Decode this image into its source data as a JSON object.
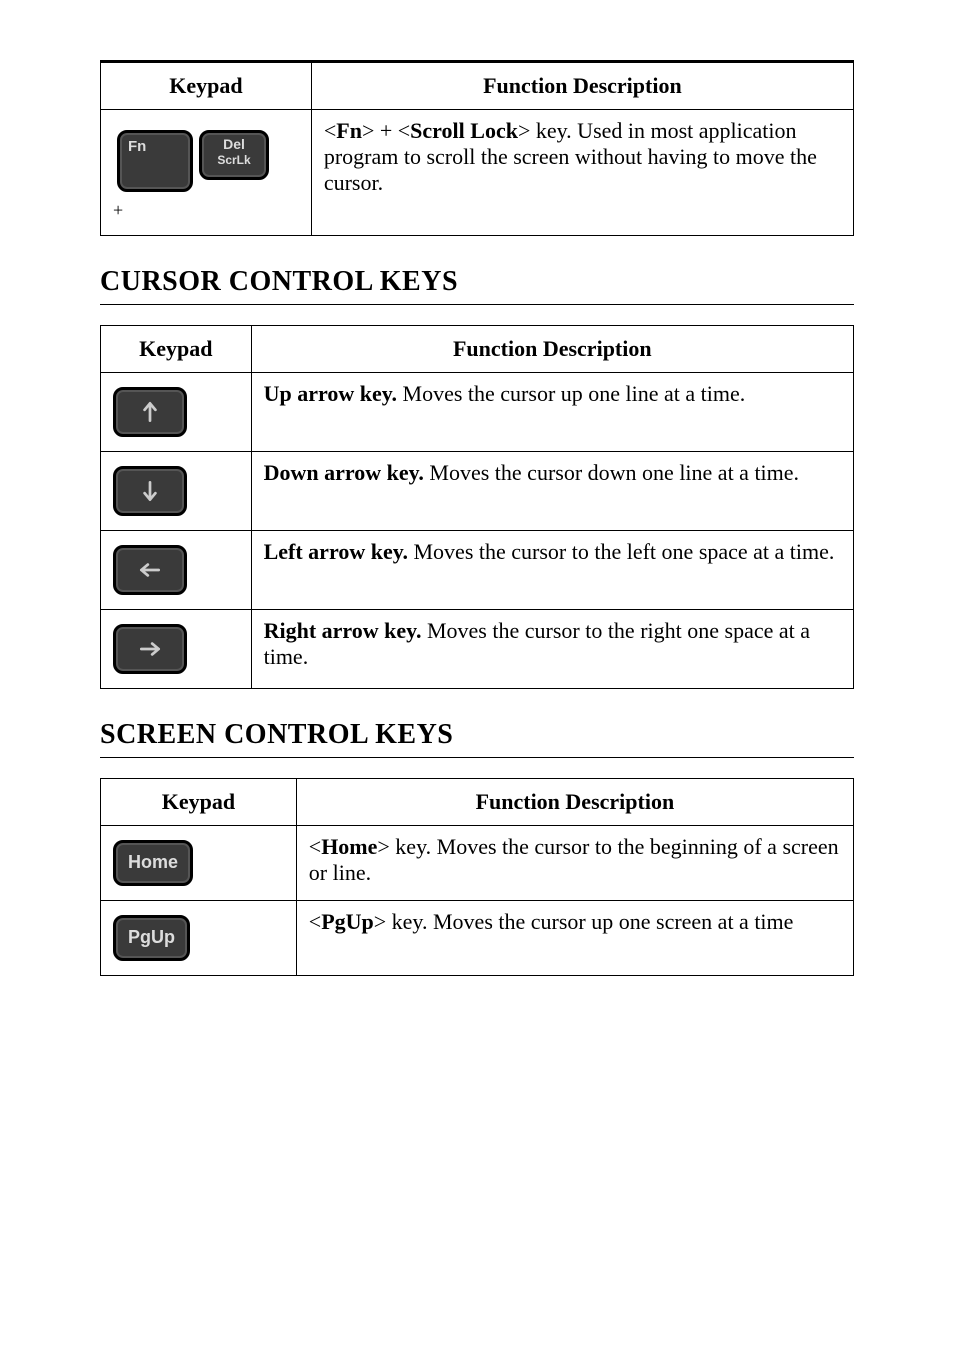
{
  "table1": {
    "headers": {
      "keypad": "Keypad",
      "desc": "Function Description"
    },
    "row": {
      "key_fn": "Fn",
      "key_del_l1": "Del",
      "key_del_l2": "ScrLk",
      "plus": "+",
      "desc_before": "<",
      "k1": "Fn",
      "mid": "> + <",
      "k2": "Scroll Lock",
      "desc_after": "> key. Used in most application program to scroll the screen without having to move the cursor."
    }
  },
  "h_cursor": "CURSOR CONTROL KEYS",
  "table2": {
    "headers": {
      "keypad": "Keypad",
      "desc": "Function Description"
    },
    "rows": [
      {
        "icon": "up",
        "bold": "Up arrow key.",
        "rest": " Moves the cursor up one line at a time."
      },
      {
        "icon": "down",
        "bold": "Down arrow key.",
        "rest": " Moves the cursor down one line at a time."
      },
      {
        "icon": "left",
        "bold": "Left arrow key.",
        "rest": " Moves the cursor to the left one space at a time."
      },
      {
        "icon": "right",
        "bold": "Right arrow key.",
        "rest": " Moves the cursor to the right one space at a time."
      }
    ]
  },
  "h_screen": "SCREEN CONTROL KEYS",
  "table3": {
    "headers": {
      "keypad": "Keypad",
      "desc": "Function Description"
    },
    "rows": [
      {
        "label": "Home",
        "pre": "<",
        "key": "Home",
        "post": "> key. Moves the cursor to the beginning of a screen or line."
      },
      {
        "label": "PgUp",
        "pre": "<",
        "key": "PgUp",
        "post": "> key. Moves the cursor up one screen at a time"
      }
    ]
  }
}
